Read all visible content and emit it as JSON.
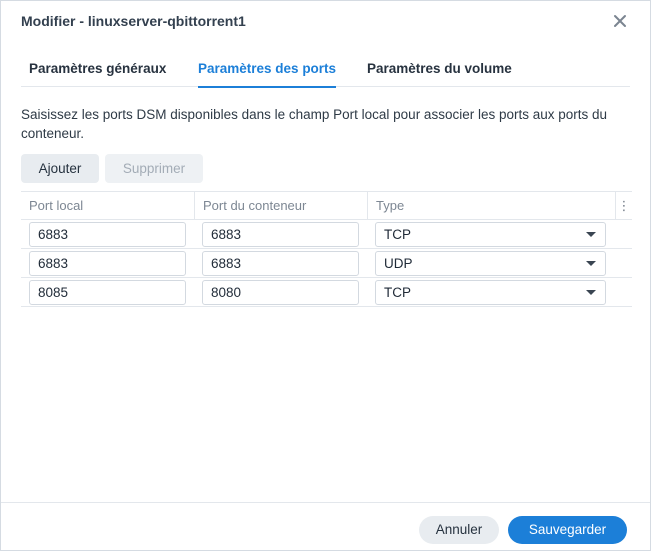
{
  "window": {
    "title": "Modifier - linuxserver-qbittorrent1"
  },
  "tabs": [
    {
      "label": "Paramètres généraux",
      "active": false
    },
    {
      "label": "Paramètres des ports",
      "active": true
    },
    {
      "label": "Paramètres du volume",
      "active": false
    }
  ],
  "description": "Saisissez les ports DSM disponibles dans le champ Port local pour associer les ports aux ports du conteneur.",
  "toolbar": {
    "add_label": "Ajouter",
    "delete_label": "Supprimer"
  },
  "table": {
    "columns": [
      "Port local",
      "Port du conteneur",
      "Type",
      "⋮"
    ],
    "rows": [
      {
        "local": "6883",
        "container": "6883",
        "type": "TCP"
      },
      {
        "local": "6883",
        "container": "6883",
        "type": "UDP"
      },
      {
        "local": "8085",
        "container": "8080",
        "type": "TCP"
      }
    ]
  },
  "footer": {
    "cancel_label": "Annuler",
    "save_label": "Sauvegarder"
  },
  "icons": {
    "close": "close-icon",
    "column_menu": "more-vertical-icon",
    "dropdown": "chevron-down-icon"
  },
  "colors": {
    "accent": "#1c7fd8",
    "border": "#e3e7ec",
    "button_bg": "#e8ecf0"
  }
}
